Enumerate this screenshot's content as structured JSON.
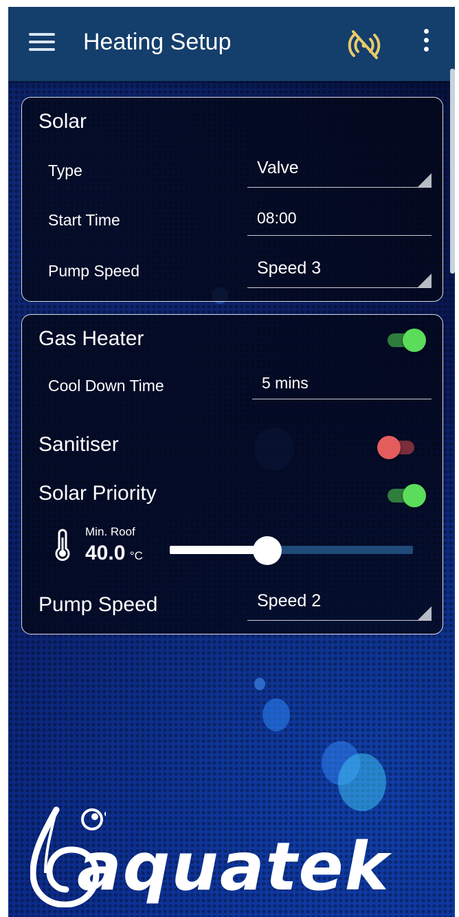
{
  "appbar": {
    "title": "Heating Setup",
    "menu_icon": "hamburger-menu-icon",
    "signal_icon": "no-signal-icon",
    "more_icon": "more-vertical-icon",
    "signal_color": "#e8c96a"
  },
  "solar": {
    "title": "Solar",
    "type_label": "Type",
    "type_value": "Valve",
    "start_time_label": "Start Time",
    "start_time_value": "08:00",
    "pump_speed_label": "Pump Speed",
    "pump_speed_value": "Speed 3"
  },
  "gas_heater": {
    "title": "Gas Heater",
    "enabled": true,
    "cool_down_label": "Cool Down Time",
    "cool_down_value": "5 mins",
    "sanitiser_label": "Sanitiser",
    "sanitiser_enabled": false,
    "solar_priority_label": "Solar Priority",
    "solar_priority_enabled": true,
    "min_roof_label": "Min. Roof",
    "min_roof_value": "40.0",
    "min_roof_unit": "°C",
    "min_roof_slider_fraction": 0.4,
    "pump_speed_label": "Pump Speed",
    "pump_speed_value": "Speed 2",
    "thermometer_icon": "thermometer-icon"
  },
  "brand": {
    "logo_text": "aquatek",
    "logo_icon": "water-drop-logo-icon"
  },
  "colors": {
    "appbar": "#143e6b",
    "toggle_on": "#5bdc5b",
    "toggle_off": "#e35d5d"
  }
}
